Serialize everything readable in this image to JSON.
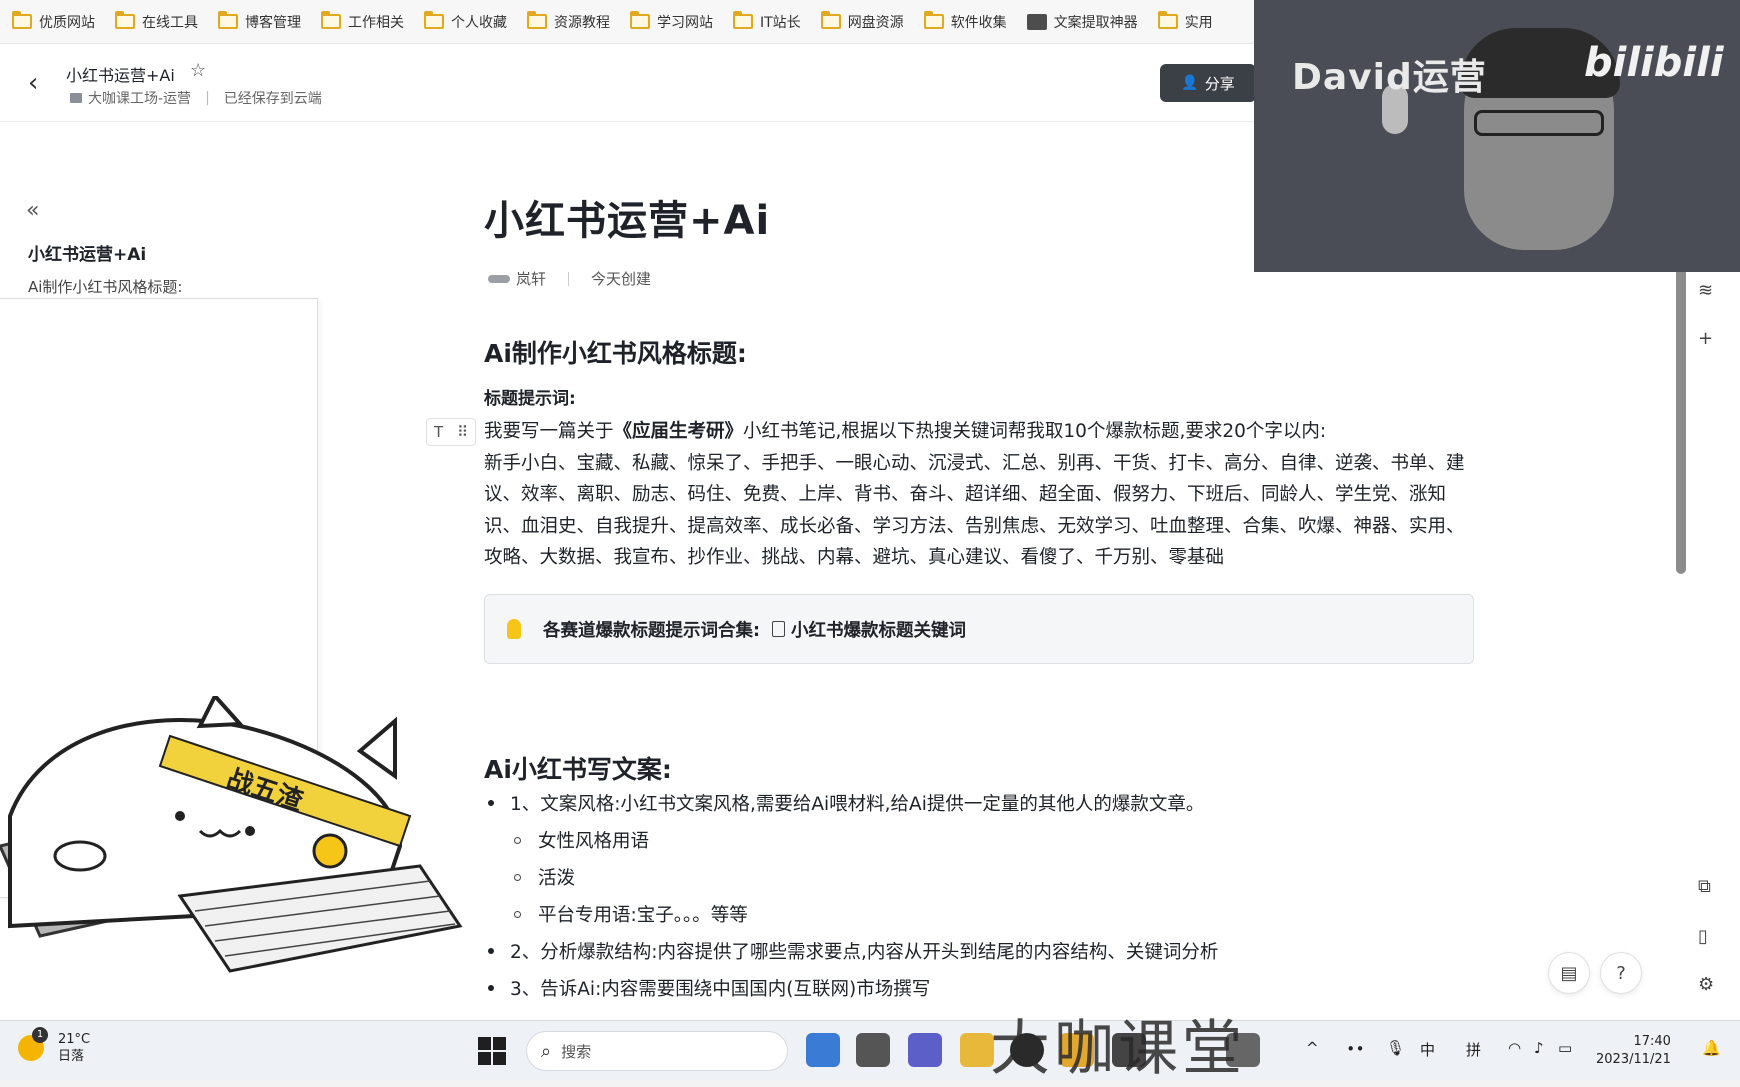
{
  "bookmarks": [
    "优质网站",
    "在线工具",
    "博客管理",
    "工作相关",
    "个人收藏",
    "资源教程",
    "学习网站",
    "IT站长",
    "网盘资源",
    "软件收集",
    "文案提取神器",
    "实用"
  ],
  "header": {
    "title": "小红书运营+Ai",
    "breadcrumb": "大咖课工场-运营",
    "save_status": "已经保存到云端",
    "share_label": "分享"
  },
  "sidebar": {
    "title": "小红书运营+Ai",
    "items": [
      "Ai制作小红书风格标题:"
    ]
  },
  "doc": {
    "title": "小红书运营+Ai",
    "author": "岚轩",
    "created": "今天创建",
    "section1": {
      "heading": "Ai制作小红书风格标题:",
      "label": "标题提示词:",
      "prompt_pre": "我要写一篇关于",
      "prompt_bold": "《应届生考研》",
      "prompt_post": "小红书笔记,根据以下热搜关键词帮我取10个爆款标题,要求20个字以内:",
      "keywords": "新手小白、宝藏、私藏、惊呆了、手把手、一眼心动、沉浸式、汇总、别再、干货、打卡、高分、自律、逆袭、书单、建议、效率、离职、励志、码住、免费、上岸、背书、奋斗、超详细、超全面、假努力、下班后、同龄人、学生党、涨知识、血泪史、自我提升、提高效率、成长必备、学习方法、告别焦虑、无效学习、吐血整理、合集、吹爆、神器、实用、攻略、大数据、我宣布、抄作业、挑战、内幕、避坑、真心建议、看傻了、千万别、零基础",
      "callout_text": "各赛道爆款标题提示词合集:",
      "callout_link": "小红书爆款标题关键词"
    },
    "section2": {
      "heading": "Ai小红书写文案:",
      "items": [
        "1、文案风格:小红书文案风格,需要给Ai喂材料,给Ai提供一定量的其他人的爆款文章。",
        "女性风格用语",
        "活泼",
        "平台专用语:宝子。。。等等",
        "2、分析爆款结构:内容提供了哪些需求要点,内容从开头到结尾的内容结构、关键词分析",
        "3、告诉Ai:内容需要围绕中国国内(互联网)市场撰写"
      ]
    },
    "block_tool": "T"
  },
  "webcam": {
    "overlay_text": "David运营",
    "logo_text": "bilibili"
  },
  "mascot": {
    "headband_text": "战五渣"
  },
  "taskbar": {
    "temp": "21°C",
    "weather": "日落",
    "notification_count": "1",
    "search_placeholder": "搜索",
    "ime_lang": "中",
    "ime_mode": "拼",
    "time": "17:40",
    "date": "2023/11/21"
  },
  "watermark": "大咖课堂",
  "colors": {
    "accent_dark": "#3b3f46",
    "folder": "#e0a91f",
    "bulb": "#f5c518",
    "callout_bg": "#f5f6f7"
  }
}
